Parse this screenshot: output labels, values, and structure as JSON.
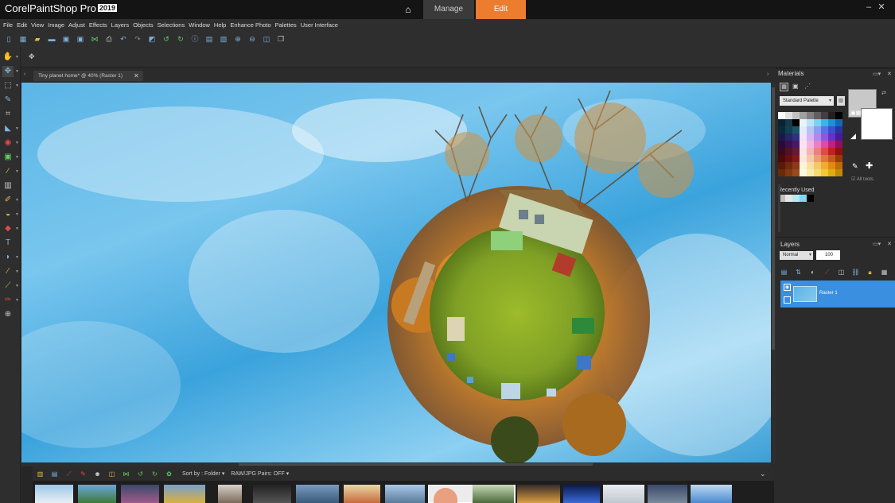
{
  "app": {
    "brand": "Corel",
    "product": "PaintShop Pro",
    "version": "2019"
  },
  "workspace_tabs": {
    "manage": "Manage",
    "edit": "Edit",
    "active": "Edit"
  },
  "menu": [
    "File",
    "Edit",
    "View",
    "Image",
    "Adjust",
    "Effects",
    "Layers",
    "Objects",
    "Selections",
    "Window",
    "Help",
    "Enhance Photo",
    "Palettes",
    "User Interface"
  ],
  "document": {
    "tab_title": "Tiny planet home* @  40% (Raster 1)",
    "close": "✕"
  },
  "materials": {
    "title": "Materials",
    "palette_select": "Standard Palette",
    "recently_used": "Recently Used",
    "all_tools": "All tools"
  },
  "layers": {
    "title": "Layers",
    "blend_mode": "Normal",
    "opacity": "100",
    "items": [
      {
        "name": "Raster 1"
      }
    ]
  },
  "organizer": {
    "sort_label": "Sort by :",
    "sort_value": "Folder",
    "raw_pairs": "RAW/JPG Pairs: OFF"
  },
  "colors": {
    "accent": "#ec7c2e",
    "selection": "#3a8fe0",
    "sky": "#5bb6e6",
    "grass": "#8fb22e"
  }
}
